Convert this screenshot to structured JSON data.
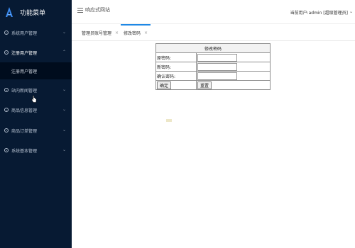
{
  "sidebar": {
    "title": "功能菜单",
    "menu": [
      {
        "label": "系统用户管理",
        "chevron": "⌄"
      },
      {
        "label": "注册用户管理",
        "chevron": "⌃"
      },
      {
        "label": "站内新闻管理",
        "chevron": "⌄"
      },
      {
        "label": "商品信息管理",
        "chevron": "⌄"
      },
      {
        "label": "商品订单管理",
        "chevron": "⌄"
      },
      {
        "label": "系统基本管理",
        "chevron": "⌄"
      }
    ],
    "submenu": {
      "label": "注册用户管理"
    }
  },
  "header": {
    "site_title": "响应式网站",
    "user_info": "当前用户:admin [超级管理员]",
    "caret": "⌄"
  },
  "tabs": [
    {
      "label": "管理员账号管理",
      "close": "×"
    },
    {
      "label": "修改密码",
      "close": "×"
    }
  ],
  "form": {
    "caption": "修改密码",
    "old_password_label": "原密码:",
    "new_password_label": "新密码:",
    "confirm_password_label": "确认密码:",
    "submit_label": "确定",
    "reset_label": "重置"
  },
  "colors": {
    "sidebar_bg": "#071a33",
    "submenu_bg": "#000c1d",
    "tab_accent": "#1e88e5"
  },
  "icons": {
    "logo": "logo-a-icon",
    "menu_item": "circle-icon",
    "hamburger": "menu-icon"
  }
}
